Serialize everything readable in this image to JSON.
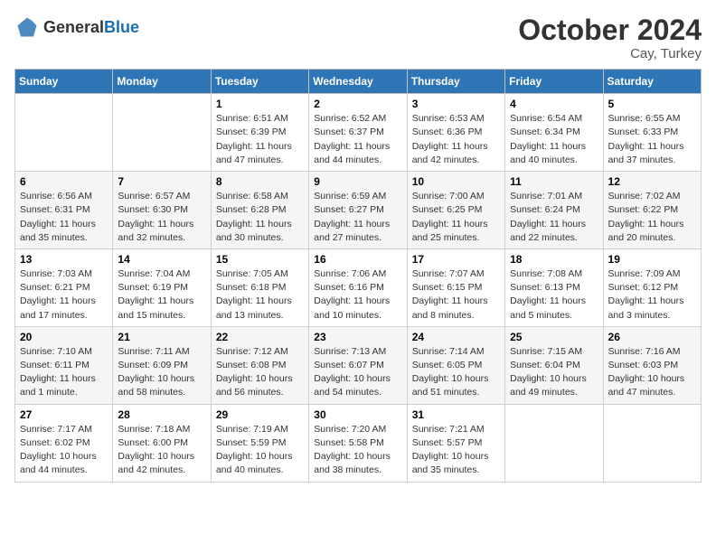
{
  "header": {
    "logo_general": "General",
    "logo_blue": "Blue",
    "month": "October 2024",
    "location": "Cay, Turkey"
  },
  "days_of_week": [
    "Sunday",
    "Monday",
    "Tuesday",
    "Wednesday",
    "Thursday",
    "Friday",
    "Saturday"
  ],
  "weeks": [
    [
      {
        "day": "",
        "sunrise": "",
        "sunset": "",
        "daylight": ""
      },
      {
        "day": "",
        "sunrise": "",
        "sunset": "",
        "daylight": ""
      },
      {
        "day": "1",
        "sunrise": "Sunrise: 6:51 AM",
        "sunset": "Sunset: 6:39 PM",
        "daylight": "Daylight: 11 hours and 47 minutes."
      },
      {
        "day": "2",
        "sunrise": "Sunrise: 6:52 AM",
        "sunset": "Sunset: 6:37 PM",
        "daylight": "Daylight: 11 hours and 44 minutes."
      },
      {
        "day": "3",
        "sunrise": "Sunrise: 6:53 AM",
        "sunset": "Sunset: 6:36 PM",
        "daylight": "Daylight: 11 hours and 42 minutes."
      },
      {
        "day": "4",
        "sunrise": "Sunrise: 6:54 AM",
        "sunset": "Sunset: 6:34 PM",
        "daylight": "Daylight: 11 hours and 40 minutes."
      },
      {
        "day": "5",
        "sunrise": "Sunrise: 6:55 AM",
        "sunset": "Sunset: 6:33 PM",
        "daylight": "Daylight: 11 hours and 37 minutes."
      }
    ],
    [
      {
        "day": "6",
        "sunrise": "Sunrise: 6:56 AM",
        "sunset": "Sunset: 6:31 PM",
        "daylight": "Daylight: 11 hours and 35 minutes."
      },
      {
        "day": "7",
        "sunrise": "Sunrise: 6:57 AM",
        "sunset": "Sunset: 6:30 PM",
        "daylight": "Daylight: 11 hours and 32 minutes."
      },
      {
        "day": "8",
        "sunrise": "Sunrise: 6:58 AM",
        "sunset": "Sunset: 6:28 PM",
        "daylight": "Daylight: 11 hours and 30 minutes."
      },
      {
        "day": "9",
        "sunrise": "Sunrise: 6:59 AM",
        "sunset": "Sunset: 6:27 PM",
        "daylight": "Daylight: 11 hours and 27 minutes."
      },
      {
        "day": "10",
        "sunrise": "Sunrise: 7:00 AM",
        "sunset": "Sunset: 6:25 PM",
        "daylight": "Daylight: 11 hours and 25 minutes."
      },
      {
        "day": "11",
        "sunrise": "Sunrise: 7:01 AM",
        "sunset": "Sunset: 6:24 PM",
        "daylight": "Daylight: 11 hours and 22 minutes."
      },
      {
        "day": "12",
        "sunrise": "Sunrise: 7:02 AM",
        "sunset": "Sunset: 6:22 PM",
        "daylight": "Daylight: 11 hours and 20 minutes."
      }
    ],
    [
      {
        "day": "13",
        "sunrise": "Sunrise: 7:03 AM",
        "sunset": "Sunset: 6:21 PM",
        "daylight": "Daylight: 11 hours and 17 minutes."
      },
      {
        "day": "14",
        "sunrise": "Sunrise: 7:04 AM",
        "sunset": "Sunset: 6:19 PM",
        "daylight": "Daylight: 11 hours and 15 minutes."
      },
      {
        "day": "15",
        "sunrise": "Sunrise: 7:05 AM",
        "sunset": "Sunset: 6:18 PM",
        "daylight": "Daylight: 11 hours and 13 minutes."
      },
      {
        "day": "16",
        "sunrise": "Sunrise: 7:06 AM",
        "sunset": "Sunset: 6:16 PM",
        "daylight": "Daylight: 11 hours and 10 minutes."
      },
      {
        "day": "17",
        "sunrise": "Sunrise: 7:07 AM",
        "sunset": "Sunset: 6:15 PM",
        "daylight": "Daylight: 11 hours and 8 minutes."
      },
      {
        "day": "18",
        "sunrise": "Sunrise: 7:08 AM",
        "sunset": "Sunset: 6:13 PM",
        "daylight": "Daylight: 11 hours and 5 minutes."
      },
      {
        "day": "19",
        "sunrise": "Sunrise: 7:09 AM",
        "sunset": "Sunset: 6:12 PM",
        "daylight": "Daylight: 11 hours and 3 minutes."
      }
    ],
    [
      {
        "day": "20",
        "sunrise": "Sunrise: 7:10 AM",
        "sunset": "Sunset: 6:11 PM",
        "daylight": "Daylight: 11 hours and 1 minute."
      },
      {
        "day": "21",
        "sunrise": "Sunrise: 7:11 AM",
        "sunset": "Sunset: 6:09 PM",
        "daylight": "Daylight: 10 hours and 58 minutes."
      },
      {
        "day": "22",
        "sunrise": "Sunrise: 7:12 AM",
        "sunset": "Sunset: 6:08 PM",
        "daylight": "Daylight: 10 hours and 56 minutes."
      },
      {
        "day": "23",
        "sunrise": "Sunrise: 7:13 AM",
        "sunset": "Sunset: 6:07 PM",
        "daylight": "Daylight: 10 hours and 54 minutes."
      },
      {
        "day": "24",
        "sunrise": "Sunrise: 7:14 AM",
        "sunset": "Sunset: 6:05 PM",
        "daylight": "Daylight: 10 hours and 51 minutes."
      },
      {
        "day": "25",
        "sunrise": "Sunrise: 7:15 AM",
        "sunset": "Sunset: 6:04 PM",
        "daylight": "Daylight: 10 hours and 49 minutes."
      },
      {
        "day": "26",
        "sunrise": "Sunrise: 7:16 AM",
        "sunset": "Sunset: 6:03 PM",
        "daylight": "Daylight: 10 hours and 47 minutes."
      }
    ],
    [
      {
        "day": "27",
        "sunrise": "Sunrise: 7:17 AM",
        "sunset": "Sunset: 6:02 PM",
        "daylight": "Daylight: 10 hours and 44 minutes."
      },
      {
        "day": "28",
        "sunrise": "Sunrise: 7:18 AM",
        "sunset": "Sunset: 6:00 PM",
        "daylight": "Daylight: 10 hours and 42 minutes."
      },
      {
        "day": "29",
        "sunrise": "Sunrise: 7:19 AM",
        "sunset": "Sunset: 5:59 PM",
        "daylight": "Daylight: 10 hours and 40 minutes."
      },
      {
        "day": "30",
        "sunrise": "Sunrise: 7:20 AM",
        "sunset": "Sunset: 5:58 PM",
        "daylight": "Daylight: 10 hours and 38 minutes."
      },
      {
        "day": "31",
        "sunrise": "Sunrise: 7:21 AM",
        "sunset": "Sunset: 5:57 PM",
        "daylight": "Daylight: 10 hours and 35 minutes."
      },
      {
        "day": "",
        "sunrise": "",
        "sunset": "",
        "daylight": ""
      },
      {
        "day": "",
        "sunrise": "",
        "sunset": "",
        "daylight": ""
      }
    ]
  ]
}
